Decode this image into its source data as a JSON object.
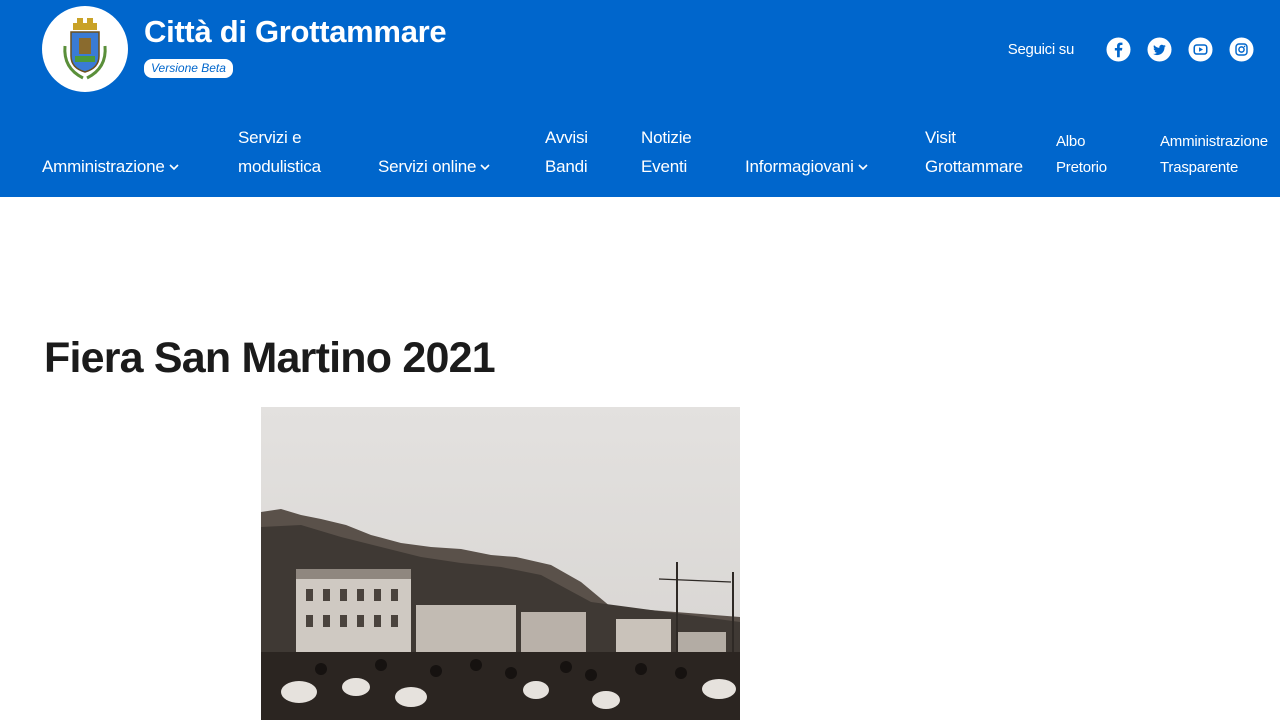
{
  "header": {
    "site_title": "Città di Grottammare",
    "beta_label": "Versione Beta",
    "social_label": "Seguici su",
    "social_icons": [
      "facebook-icon",
      "twitter-icon",
      "youtube-icon",
      "instagram-icon"
    ],
    "brand_color": "#0066cc"
  },
  "nav": {
    "amministrazione": "Amministrazione",
    "servizi_line1": "Servizi e",
    "servizi_line2": "modulistica",
    "servizi_online": "Servizi online",
    "avvisi_line1": "Avvisi",
    "avvisi_line2": "Bandi",
    "notizie_line1": "Notizie",
    "notizie_line2": "Eventi",
    "informagiovani": "Informagiovani",
    "visit_line1": "Visit",
    "visit_line2": "Grottammare",
    "albo_line1": "Albo",
    "albo_line2": "Pretorio",
    "trasparente_line1": "Amministrazione",
    "trasparente_line2": "Trasparente"
  },
  "main": {
    "page_title": "Fiera San Martino 2021"
  }
}
